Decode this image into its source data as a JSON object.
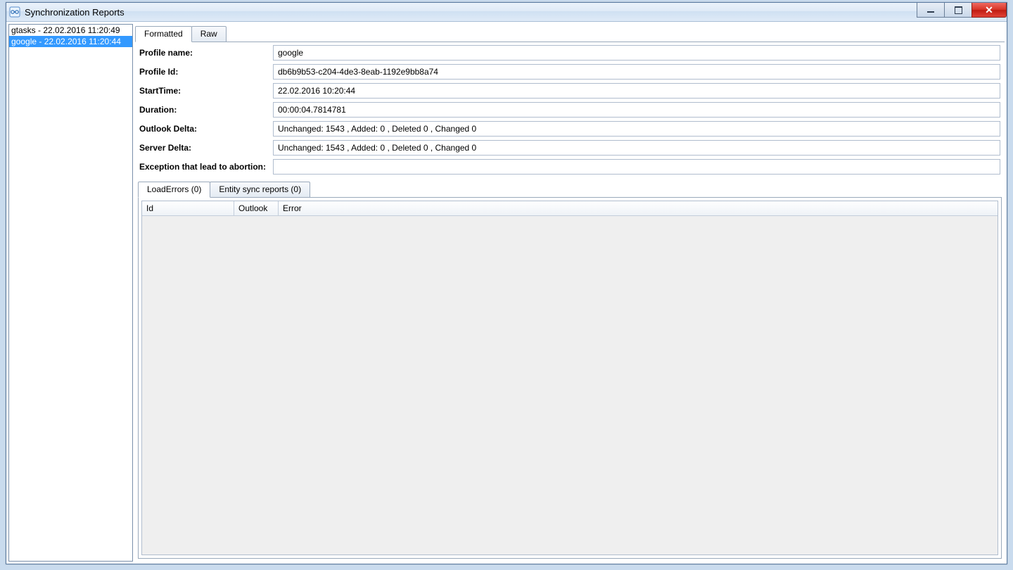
{
  "window": {
    "title": "Synchronization Reports"
  },
  "sidebar": {
    "items": [
      {
        "label": "gtasks - 22.02.2016 11:20:49",
        "selected": false
      },
      {
        "label": "google - 22.02.2016 11:20:44",
        "selected": true
      }
    ]
  },
  "topTabs": {
    "formatted": "Formatted",
    "raw": "Raw"
  },
  "fields": {
    "profileName": {
      "label": "Profile name:",
      "value": "google"
    },
    "profileId": {
      "label": "Profile Id:",
      "value": "db6b9b53-c204-4de3-8eab-1192e9bb8a74"
    },
    "startTime": {
      "label": "StartTime:",
      "value": "22.02.2016 10:20:44"
    },
    "duration": {
      "label": "Duration:",
      "value": "00:00:04.7814781"
    },
    "outlookDelta": {
      "label": "Outlook Delta:",
      "value": "Unchanged: 1543 , Added: 0 , Deleted 0 ,  Changed 0"
    },
    "serverDelta": {
      "label": "Server Delta:",
      "value": "Unchanged: 1543 , Added: 0 , Deleted 0 ,  Changed 0"
    },
    "exception": {
      "label": "Exception that lead to abortion:",
      "value": ""
    }
  },
  "subTabs": {
    "loadErrors": "LoadErrors (0)",
    "entitySync": "Entity sync reports (0)"
  },
  "grid": {
    "columns": {
      "id": "Id",
      "outlook": "Outlook",
      "error": "Error"
    }
  }
}
